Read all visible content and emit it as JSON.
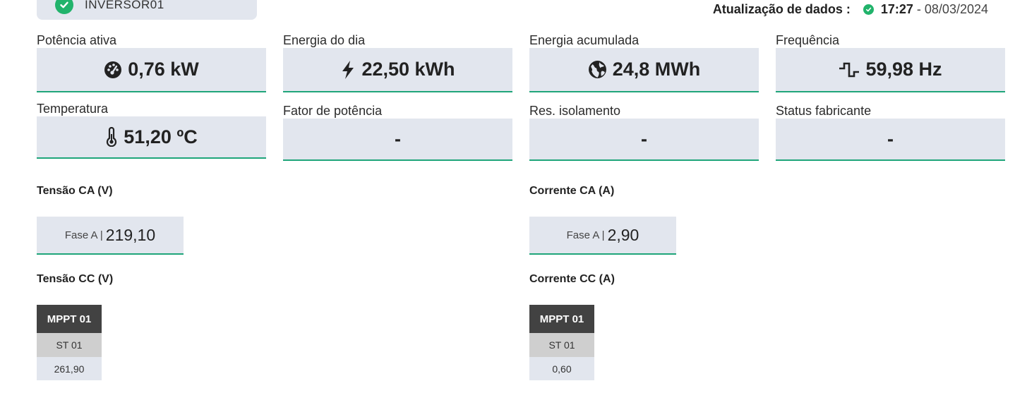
{
  "device": {
    "name": "INVERSOR01"
  },
  "update": {
    "label": "Atualização de dados :",
    "time": "17:27",
    "separator": "-",
    "date": "08/03/2024"
  },
  "cards": {
    "power": {
      "label": "Potência ativa",
      "value": "0,76 kW",
      "icon": "gauge-icon"
    },
    "energy_day": {
      "label": "Energia do dia",
      "value": "22,50 kWh",
      "icon": "bolt-icon"
    },
    "energy_total": {
      "label": "Energia acumulada",
      "value": "24,8 MWh",
      "icon": "globe-icon"
    },
    "frequency": {
      "label": "Frequência",
      "value": "59,98 Hz",
      "icon": "square-wave-icon"
    },
    "temperature": {
      "label": "Temperatura",
      "value": "51,20 ºC",
      "icon": "thermometer-icon"
    },
    "power_factor": {
      "label": "Fator de potência",
      "value": "-"
    },
    "insulation": {
      "label": "Res. isolamento",
      "value": "-"
    },
    "status": {
      "label": "Status fabricante",
      "value": "-"
    }
  },
  "ac_voltage": {
    "title": "Tensão CA (V)",
    "phase_label": "Fase A |",
    "phase_value": "219,10"
  },
  "ac_current": {
    "title": "Corrente CA (A)",
    "phase_label": "Fase A |",
    "phase_value": "2,90"
  },
  "dc_voltage": {
    "title": "Tensão CC (V)",
    "mppt": "MPPT 01",
    "string": "ST 01",
    "value": "261,90"
  },
  "dc_current": {
    "title": "Corrente CC (A)",
    "mppt": "MPPT 01",
    "string": "ST 01",
    "value": "0,60"
  },
  "colors": {
    "accent": "#1fa57a",
    "ok": "#21b36b",
    "card_bg": "#e2e6ee",
    "header_dark": "#424242"
  }
}
